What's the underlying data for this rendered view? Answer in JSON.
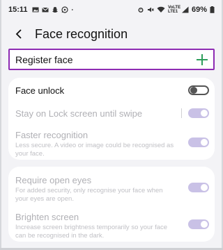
{
  "status_bar": {
    "time": "15:11",
    "network": "VoLTE LTE1",
    "battery": "69%",
    "icons_left": [
      "gallery-icon",
      "mail-icon",
      "snapchat-icon",
      "whatsapp-icon",
      "dot-icon"
    ],
    "icons_right": [
      "alarm-icon",
      "mute-icon",
      "wifi-icon",
      "signal-icon",
      "battery-icon"
    ]
  },
  "header": {
    "title": "Face recognition"
  },
  "register": {
    "label": "Register face",
    "accent_color": "#2e9e5b",
    "highlight_color": "#8e2bb3"
  },
  "settings": {
    "face_unlock": {
      "title": "Face unlock",
      "enabled": false
    },
    "stay_on_lock": {
      "title": "Stay on Lock screen until swipe",
      "enabled": true
    },
    "faster_recognition": {
      "title": "Faster recognition",
      "subtitle": "Less secure. A video or image could be recognised as your face.",
      "enabled": true
    },
    "require_open_eyes": {
      "title": "Require open eyes",
      "subtitle": "For added security, only recognise your face when your eyes are open.",
      "enabled": true
    },
    "brighten_screen": {
      "title": "Brighten screen",
      "subtitle": "Increase screen brightness temporarily so your face can be recognised in the dark.",
      "enabled": true
    }
  }
}
